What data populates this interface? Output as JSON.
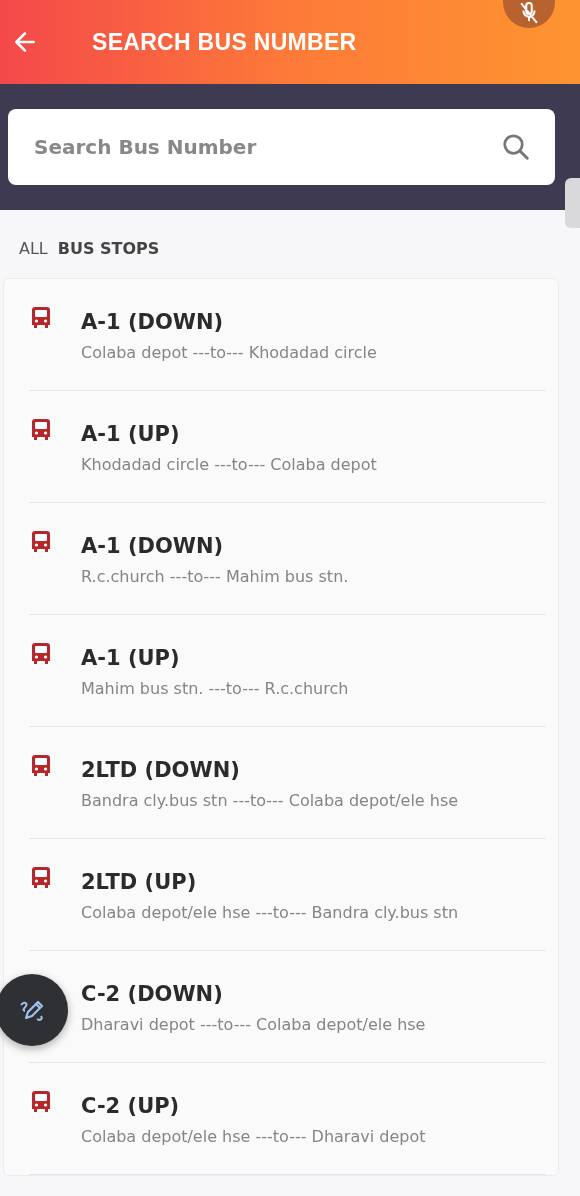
{
  "header": {
    "title": "SEARCH BUS NUMBER"
  },
  "search": {
    "placeholder": "Search Bus Number"
  },
  "tabs": [
    {
      "label": "ALL",
      "selected": false
    },
    {
      "label": "BUS STOPS",
      "selected": true
    }
  ],
  "routes": [
    {
      "number": "A-1 (DOWN)",
      "route": "Colaba depot ---to--- Khodadad circle",
      "show_icon": true
    },
    {
      "number": "A-1 (UP)",
      "route": "Khodadad circle ---to--- Colaba depot",
      "show_icon": true
    },
    {
      "number": "A-1 (DOWN)",
      "route": "R.c.church ---to--- Mahim bus stn.",
      "show_icon": true
    },
    {
      "number": "A-1 (UP)",
      "route": "Mahim bus stn. ---to--- R.c.church",
      "show_icon": true
    },
    {
      "number": "2LTD (DOWN)",
      "route": "Bandra cly.bus stn ---to--- Colaba depot/ele hse",
      "show_icon": true
    },
    {
      "number": "2LTD (UP)",
      "route": "Colaba depot/ele hse ---to--- Bandra cly.bus stn",
      "show_icon": true
    },
    {
      "number": "C-2 (DOWN)",
      "route": "Dharavi depot ---to--- Colaba depot/ele hse",
      "show_icon": false
    },
    {
      "number": "C-2 (UP)",
      "route": "Colaba depot/ele hse ---to--- Dharavi depot",
      "show_icon": true
    }
  ]
}
